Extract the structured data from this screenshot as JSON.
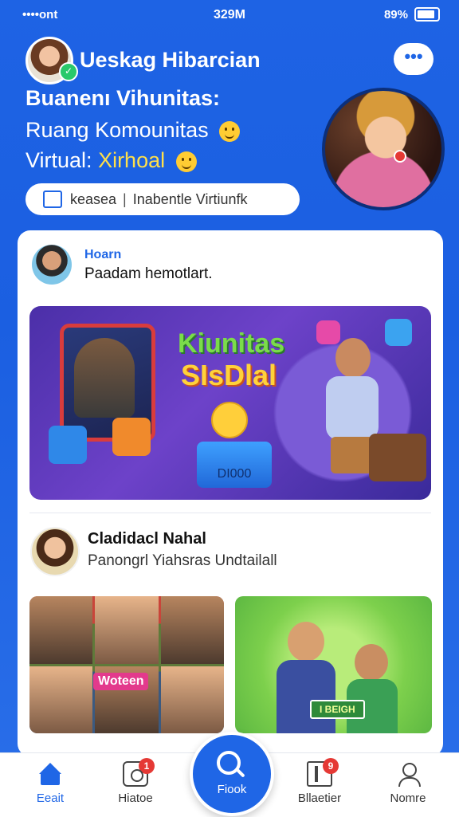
{
  "status_bar": {
    "carrier": "••••ont",
    "time": "329M",
    "battery_text": "89%"
  },
  "header": {
    "app_title": "Ueskag Hibarcian",
    "subtitle": "Buanenı Vihunitas:",
    "tagline_line1": "Ruang Komounitas",
    "tagline_line2_prefix": "Virtual:",
    "tagline_line2_highlight": "Xirhoal",
    "search_pill_left": "keasea",
    "search_pill_divider": "|",
    "search_pill_right": "Inabentle Virtiunfk",
    "more_label": "•••"
  },
  "post1": {
    "user": "Hoarn",
    "text": "Paadam hemotlart.",
    "banner_title1": "Kiunitas",
    "banner_title2": "SIsDlal",
    "banner_console": "DI000"
  },
  "post2": {
    "name": "Cladidacl Nahal",
    "subtitle": "Panongrl Yiahsras Undtailall",
    "thumb1_label": "Woteen",
    "thumb2_sign": "I BEIGH"
  },
  "nav": {
    "items": [
      {
        "label": "Eeait",
        "icon": "home-icon",
        "active": true
      },
      {
        "label": "Hiatoe",
        "icon": "photo-icon",
        "badge": "1"
      },
      {
        "label": "Fiook",
        "icon": "search-icon"
      },
      {
        "label": "Bllaetier",
        "icon": "book-icon",
        "badge": "9"
      },
      {
        "label": "Nomre",
        "icon": "user-icon"
      }
    ]
  },
  "colors": {
    "primary": "#1f66e6",
    "badge": "#e53935",
    "highlight": "#ffe04a"
  }
}
